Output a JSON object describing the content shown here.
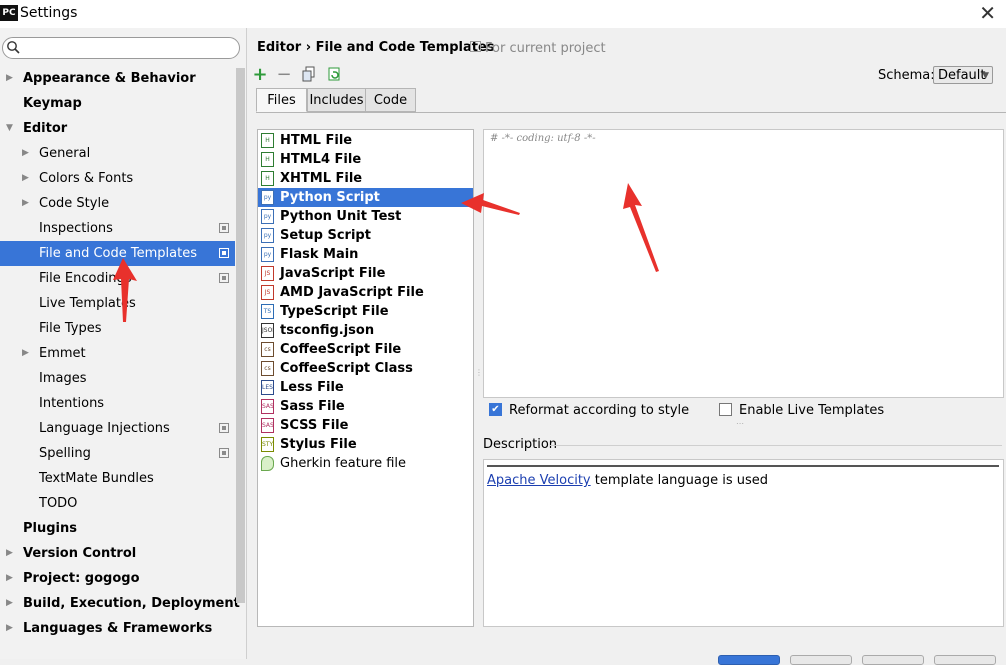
{
  "window": {
    "title": "Settings",
    "app_badge": "PC",
    "close_glyph": "✕"
  },
  "search": {
    "placeholder": "",
    "icon": "search-icon"
  },
  "tree": [
    {
      "label": "Appearance & Behavior",
      "level": 0,
      "arrow": true
    },
    {
      "label": "Keymap",
      "level": 0,
      "arrow": false
    },
    {
      "label": "Editor",
      "level": 0,
      "arrow": true,
      "expanded": true
    },
    {
      "label": "General",
      "level": 1,
      "arrow": true
    },
    {
      "label": "Colors & Fonts",
      "level": 1,
      "arrow": true
    },
    {
      "label": "Code Style",
      "level": 1,
      "arrow": true
    },
    {
      "label": "Inspections",
      "level": 1,
      "arrow": false,
      "project": true
    },
    {
      "label": "File and Code Templates",
      "level": 1,
      "arrow": false,
      "project": true,
      "selected": true
    },
    {
      "label": "File Encodings",
      "level": 1,
      "arrow": false,
      "project": true
    },
    {
      "label": "Live Templates",
      "level": 1,
      "arrow": false
    },
    {
      "label": "File Types",
      "level": 1,
      "arrow": false
    },
    {
      "label": "Emmet",
      "level": 1,
      "arrow": true
    },
    {
      "label": "Images",
      "level": 1,
      "arrow": false
    },
    {
      "label": "Intentions",
      "level": 1,
      "arrow": false
    },
    {
      "label": "Language Injections",
      "level": 1,
      "arrow": false,
      "project": true
    },
    {
      "label": "Spelling",
      "level": 1,
      "arrow": false,
      "project": true
    },
    {
      "label": "TextMate Bundles",
      "level": 1,
      "arrow": false
    },
    {
      "label": "TODO",
      "level": 1,
      "arrow": false
    },
    {
      "label": "Plugins",
      "level": 0,
      "arrow": false
    },
    {
      "label": "Version Control",
      "level": 0,
      "arrow": true
    },
    {
      "label": "Project: gogogo",
      "level": 0,
      "arrow": true
    },
    {
      "label": "Build, Execution, Deployment",
      "level": 0,
      "arrow": true
    },
    {
      "label": "Languages & Frameworks",
      "level": 0,
      "arrow": true
    }
  ],
  "header": {
    "breadcrumb_parent": "Editor",
    "breadcrumb_sep": "›",
    "breadcrumb_current": "File and Code Templates",
    "scope_note": "For current project"
  },
  "toolbar": {
    "add": "+",
    "remove": "−",
    "copy_icon": "copy-icon",
    "reset_icon": "reset-icon"
  },
  "schema": {
    "label": "Schema:",
    "value": "Default"
  },
  "tabs": [
    {
      "label": "Files",
      "active": true
    },
    {
      "label": "Includes",
      "active": false
    },
    {
      "label": "Code",
      "active": false
    }
  ],
  "files": [
    {
      "name": "HTML File",
      "icon": "H",
      "color": "#2e7d32"
    },
    {
      "name": "HTML4 File",
      "icon": "H",
      "color": "#2e7d32"
    },
    {
      "name": "XHTML File",
      "icon": "H",
      "color": "#2e7d32"
    },
    {
      "name": "Python Script",
      "icon": "py",
      "color": "#3b6fb6",
      "selected": true
    },
    {
      "name": "Python Unit Test",
      "icon": "py",
      "color": "#3b6fb6"
    },
    {
      "name": "Setup Script",
      "icon": "py",
      "color": "#3b6fb6"
    },
    {
      "name": "Flask Main",
      "icon": "py",
      "color": "#3b6fb6"
    },
    {
      "name": "JavaScript File",
      "icon": "JS",
      "color": "#c0392b"
    },
    {
      "name": "AMD JavaScript File",
      "icon": "JS",
      "color": "#c0392b"
    },
    {
      "name": "TypeScript File",
      "icon": "TS",
      "color": "#2d6db5"
    },
    {
      "name": "tsconfig.json",
      "icon": "JSON",
      "color": "#333333"
    },
    {
      "name": "CoffeeScript File",
      "icon": "cs",
      "color": "#6d4c2f"
    },
    {
      "name": "CoffeeScript Class",
      "icon": "cs",
      "color": "#6d4c2f"
    },
    {
      "name": "Less File",
      "icon": "LESS",
      "color": "#2b4a8b"
    },
    {
      "name": "Sass File",
      "icon": "SASS",
      "color": "#b03060"
    },
    {
      "name": "SCSS File",
      "icon": "SASS",
      "color": "#b03060"
    },
    {
      "name": "Stylus File",
      "icon": "STYL",
      "color": "#7a8a00"
    },
    {
      "name": "Gherkin feature file",
      "icon": "",
      "color": "#6aa84f",
      "normal": true
    }
  ],
  "editor": {
    "text": "# -*- coding: utf-8 -*-"
  },
  "options": {
    "reformat": {
      "label": "Reformat according to style",
      "checked": true
    },
    "live_templates": {
      "label": "Enable Live Templates",
      "checked": false
    }
  },
  "description": {
    "label": "Description",
    "link_text": "Apache Velocity",
    "rest_text": " template language is used"
  },
  "colors": {
    "selection": "#3875d7",
    "annotation_arrow": "#e8312c",
    "link": "#1c3fb0"
  }
}
